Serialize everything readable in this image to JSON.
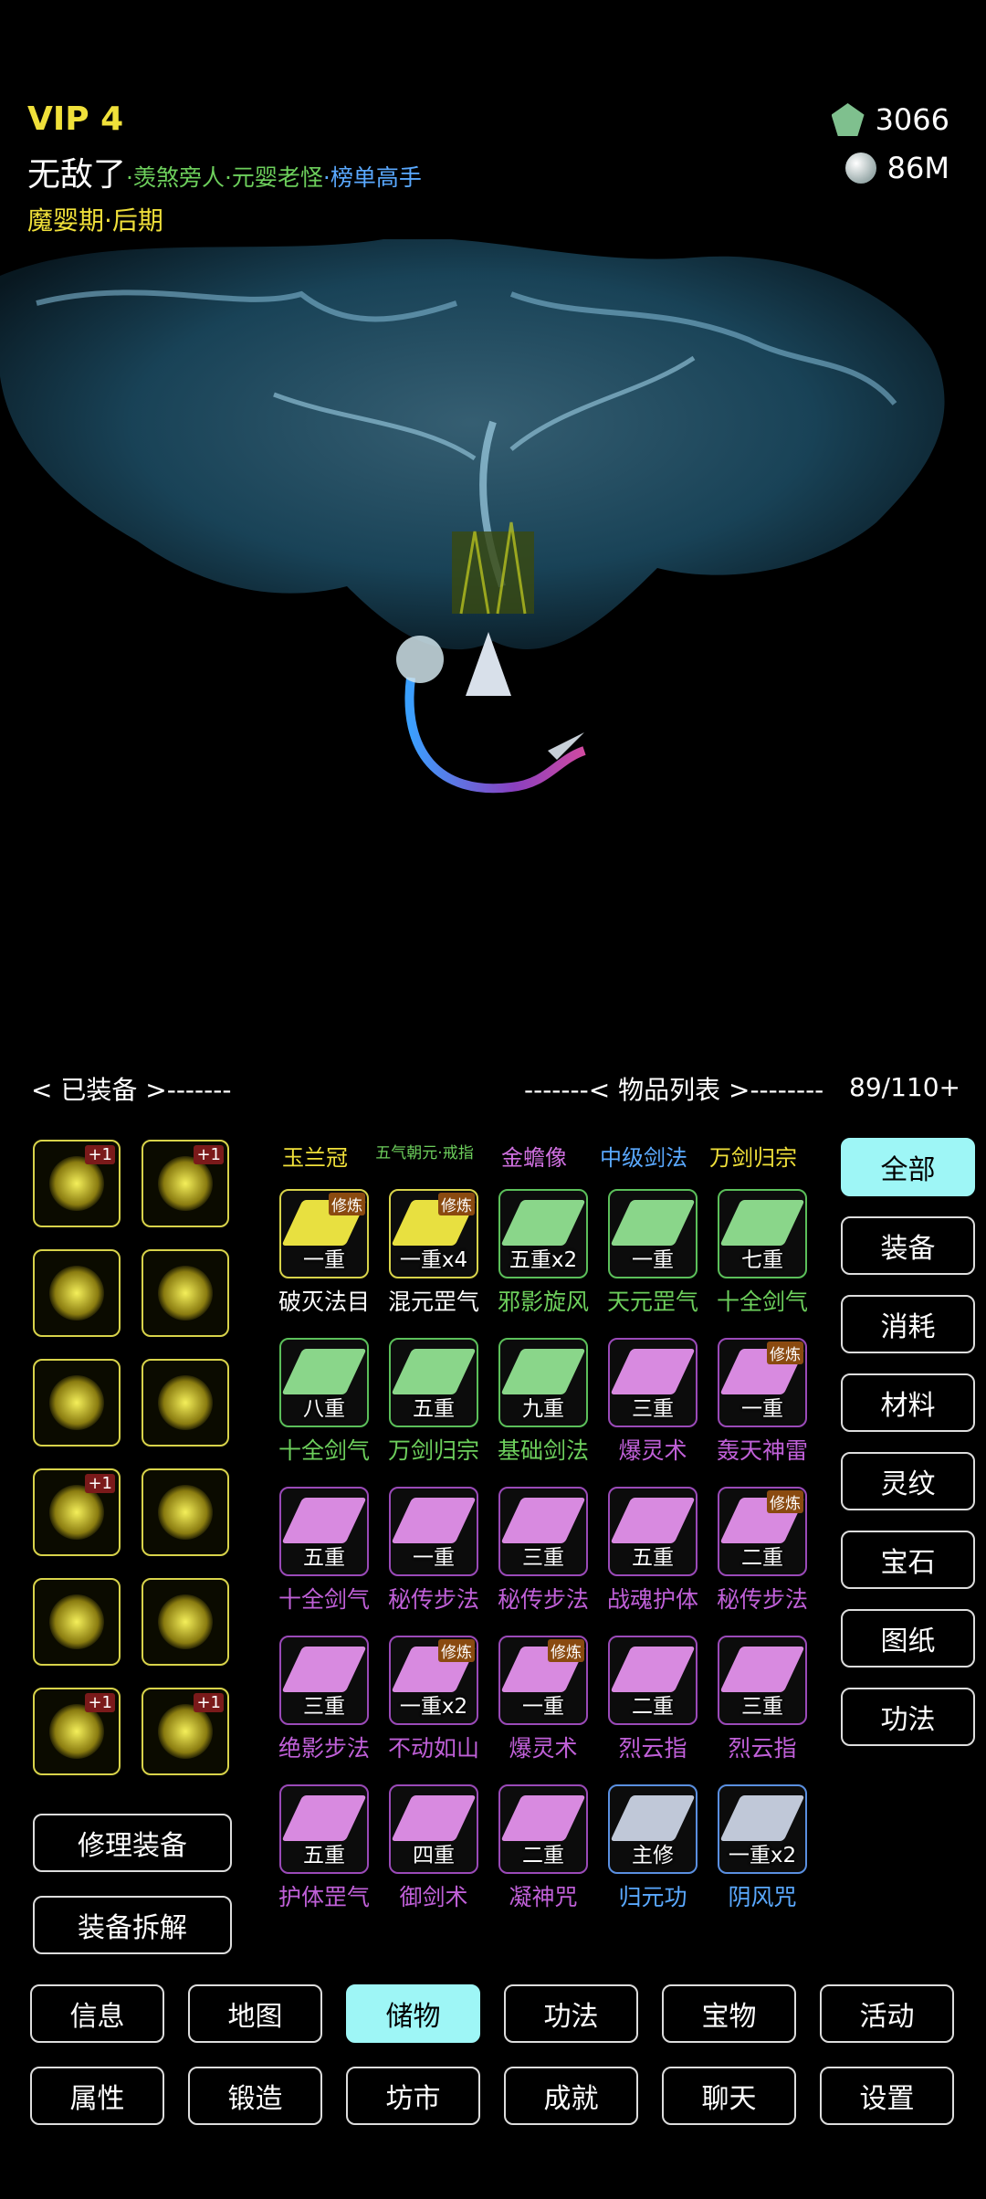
{
  "player": {
    "vip": "VIP 4",
    "name": "无敌了",
    "title_1": "·羡煞旁人",
    "title_2": "·元婴老怪",
    "title_3": "·榜单高手",
    "realm": "魔婴期·后期"
  },
  "currency": {
    "gems": "3066",
    "stones": "86M"
  },
  "equipped": {
    "header": "< 已装备 >-------",
    "slots": [
      {
        "icon": "golden-sword-icon",
        "plus": "+1"
      },
      {
        "icon": "golden-fish-icon",
        "plus": "+1"
      },
      {
        "icon": "golden-ring-icon",
        "plus": ""
      },
      {
        "icon": "golden-dragon-icon",
        "plus": ""
      },
      {
        "icon": "golden-bird-statue-icon",
        "plus": ""
      },
      {
        "icon": "golden-helmet-icon",
        "plus": ""
      },
      {
        "icon": "golden-armor-icon",
        "plus": "+1"
      },
      {
        "icon": "golden-serpent-icon",
        "plus": ""
      },
      {
        "icon": "golden-skirt-icon",
        "plus": ""
      },
      {
        "icon": "golden-boots-icon",
        "plus": ""
      },
      {
        "icon": "golden-fan-icon",
        "plus": "+1"
      },
      {
        "icon": "golden-scroll-icon",
        "plus": "+1"
      }
    ],
    "repair_label": "修理装备",
    "dismantle_label": "装备拆解"
  },
  "items": {
    "header": "-------< 物品列表 >--------",
    "count": "89/110+",
    "top_row": [
      {
        "name": "玉兰冠",
        "color": "#f0e03a"
      },
      {
        "name": "五气朝元·戒指",
        "color": "#6dcf5c"
      },
      {
        "name": "金蟾像",
        "color": "#d070e0"
      },
      {
        "name": "中级剑法",
        "color": "#5aa9ff"
      },
      {
        "name": "万剑归宗",
        "color": "#f0e03a"
      }
    ],
    "grid": [
      {
        "level": "一重",
        "tag": "修炼",
        "name": "破灭法目",
        "rarity": "gold",
        "name_color": "#ffffff"
      },
      {
        "level": "一重x4",
        "tag": "修炼",
        "name": "混元罡气",
        "rarity": "gold",
        "name_color": "#ffffff"
      },
      {
        "level": "五重x2",
        "tag": "",
        "name": "邪影旋风",
        "rarity": "green",
        "name_color": "#6dcf5c"
      },
      {
        "level": "一重",
        "tag": "",
        "name": "天元罡气",
        "rarity": "green",
        "name_color": "#6dcf5c"
      },
      {
        "level": "七重",
        "tag": "",
        "name": "十全剑气",
        "rarity": "green",
        "name_color": "#6dcf5c"
      },
      {
        "level": "八重",
        "tag": "",
        "name": "十全剑气",
        "rarity": "green",
        "name_color": "#6dcf5c"
      },
      {
        "level": "五重",
        "tag": "",
        "name": "万剑归宗",
        "rarity": "green",
        "name_color": "#6dcf5c"
      },
      {
        "level": "九重",
        "tag": "",
        "name": "基础剑法",
        "rarity": "green",
        "name_color": "#6dcf5c"
      },
      {
        "level": "三重",
        "tag": "",
        "name": "爆灵术",
        "rarity": "purple",
        "name_color": "#c060d8"
      },
      {
        "level": "一重",
        "tag": "修炼",
        "name": "轰天神雷",
        "rarity": "purple",
        "name_color": "#c060d8"
      },
      {
        "level": "五重",
        "tag": "",
        "name": "十全剑气",
        "rarity": "purple",
        "name_color": "#c060d8"
      },
      {
        "level": "一重",
        "tag": "",
        "name": "秘传步法",
        "rarity": "purple",
        "name_color": "#c060d8"
      },
      {
        "level": "三重",
        "tag": "",
        "name": "秘传步法",
        "rarity": "purple",
        "name_color": "#c060d8"
      },
      {
        "level": "五重",
        "tag": "",
        "name": "战魂护体",
        "rarity": "purple",
        "name_color": "#c060d8"
      },
      {
        "level": "二重",
        "tag": "修炼",
        "name": "秘传步法",
        "rarity": "purple",
        "name_color": "#c060d8"
      },
      {
        "level": "三重",
        "tag": "",
        "name": "绝影步法",
        "rarity": "purple",
        "name_color": "#c060d8"
      },
      {
        "level": "一重x2",
        "tag": "修炼",
        "name": "不动如山",
        "rarity": "purple",
        "name_color": "#c060d8"
      },
      {
        "level": "一重",
        "tag": "修炼",
        "name": "爆灵术",
        "rarity": "purple",
        "name_color": "#c060d8"
      },
      {
        "level": "二重",
        "tag": "",
        "name": "烈云指",
        "rarity": "purple",
        "name_color": "#c060d8"
      },
      {
        "level": "三重",
        "tag": "",
        "name": "烈云指",
        "rarity": "purple",
        "name_color": "#c060d8"
      },
      {
        "level": "五重",
        "tag": "",
        "name": "护体罡气",
        "rarity": "purple",
        "name_color": "#c060d8"
      },
      {
        "level": "四重",
        "tag": "",
        "name": "御剑术",
        "rarity": "purple",
        "name_color": "#c060d8"
      },
      {
        "level": "二重",
        "tag": "",
        "name": "凝神咒",
        "rarity": "purple",
        "name_color": "#c060d8"
      },
      {
        "level": "主修",
        "tag": "",
        "name": "归元功",
        "rarity": "blue",
        "name_color": "#5aa9ff"
      },
      {
        "level": "一重x2",
        "tag": "",
        "name": "阴风咒",
        "rarity": "blue",
        "name_color": "#5aa9ff"
      }
    ]
  },
  "categories": [
    "全部",
    "装备",
    "消耗",
    "材料",
    "灵纹",
    "宝石",
    "图纸",
    "功法"
  ],
  "active_category": "全部",
  "nav_row_1": [
    "信息",
    "地图",
    "储物",
    "功法",
    "宝物",
    "活动"
  ],
  "nav_row_2": [
    "属性",
    "锻造",
    "坊市",
    "成就",
    "聊天",
    "设置"
  ],
  "active_nav": "储物",
  "colors": {
    "accent": "#9ef6f6",
    "gold": "#d8d34a",
    "green": "#5bbf5a",
    "purple": "#9a4ab8",
    "blue": "#5a8fe0"
  }
}
